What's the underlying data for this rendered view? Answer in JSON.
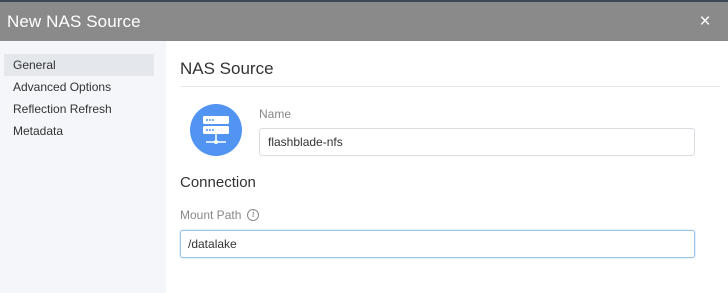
{
  "dialog": {
    "title": "New NAS Source",
    "close_label": "×"
  },
  "sidebar": {
    "items": [
      {
        "label": "General",
        "active": true
      },
      {
        "label": "Advanced Options",
        "active": false
      },
      {
        "label": "Reflection Refresh",
        "active": false
      },
      {
        "label": "Metadata",
        "active": false
      }
    ]
  },
  "main": {
    "section_title": "NAS Source",
    "icon": "server-icon",
    "name": {
      "label": "Name",
      "value": "flashblade-nfs"
    },
    "connection": {
      "title": "Connection",
      "mount_path": {
        "label": "Mount Path",
        "info_icon": "info-icon",
        "value": "/datalake"
      }
    }
  },
  "colors": {
    "header_bg": "#8a8a8a",
    "sidebar_bg": "#f4f6f9",
    "accent": "#5294f2"
  }
}
